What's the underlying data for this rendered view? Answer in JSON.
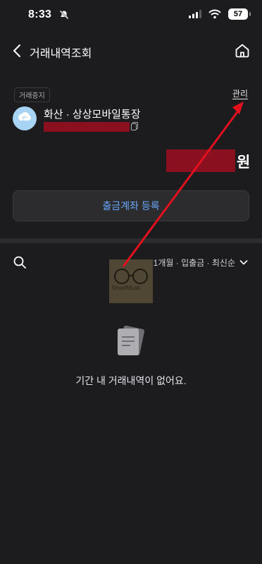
{
  "status_bar": {
    "time": "8:33",
    "battery": "57"
  },
  "header": {
    "title": "거래내역조회"
  },
  "account": {
    "status_badge": "거래중지",
    "manage_link": "관리",
    "name": "화산 · 상상모바일통장",
    "balance_unit": "원"
  },
  "register_button": "출금계좌 등록",
  "filter": {
    "summary": "1개월 · 입출금 · 최신순"
  },
  "empty_state": {
    "message": "기간 내 거래내역이 없어요."
  },
  "watermark": "SmartMLab",
  "colors": {
    "background": "#1c1c1e",
    "link_blue": "#6aa8ff",
    "redact": "#8a0f1f",
    "annotation_arrow": "#e3101e"
  },
  "icons": [
    "back-icon",
    "home-icon",
    "search-icon",
    "chevron-down-icon",
    "copy-icon",
    "bank-logo-icon",
    "empty-document-icon"
  ]
}
